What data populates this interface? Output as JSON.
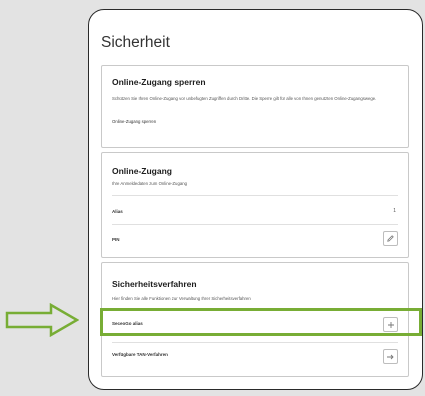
{
  "page": {
    "title": "Sicherheit"
  },
  "lock_card": {
    "title": "Online-Zugang sperren",
    "description": "Schützen Sie Ihren Online-Zugang vor unbefugten Zugriffen durch Dritte. Die Sperre gilt für alle von Ihnen genutzten Online-Zugangswege.",
    "link_label": "Online-Zugang sperren"
  },
  "access_card": {
    "title": "Online-Zugang",
    "description": "Ihre Anmeldedaten zum Online-Zugang",
    "rows": [
      {
        "label": "Alias",
        "value": "1"
      },
      {
        "label": "PIN"
      }
    ]
  },
  "security_card": {
    "title": "Sicherheitsverfahren",
    "description": "Hier finden Sie alle Funktionen zur Verwaltung Ihrer Sicherheitsverfahren",
    "rows": [
      {
        "label": "Seceo­Go alias"
      },
      {
        "label": "Verfügbare TAN-Verfahren"
      }
    ]
  },
  "colors": {
    "highlight": "#78ad35",
    "arrow": "#78ad35"
  },
  "icons": [
    "pencil-icon",
    "plus-icon",
    "arrow-right-icon",
    "hint-arrow-icon"
  ]
}
